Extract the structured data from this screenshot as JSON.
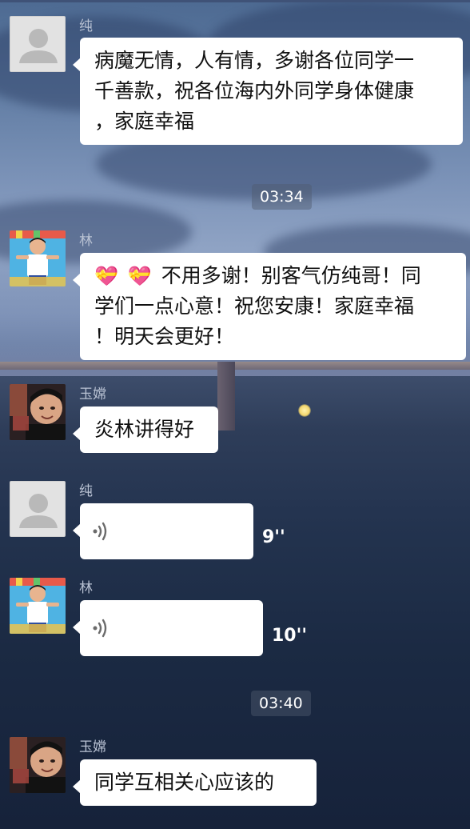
{
  "timestamps": [
    "03:34",
    "03:40"
  ],
  "messages": [
    {
      "sender": "纯",
      "avatar": "default-avatar-icon",
      "type": "text",
      "lines": [
        "病魔无情，人有情，多谢各位同学一",
        "千善款，祝各位海内外同学身体健康",
        "，家庭幸福"
      ]
    },
    {
      "sender": "林",
      "avatar": "child-photo-avatar",
      "type": "text",
      "emoji": [
        "💝",
        "💝"
      ],
      "lines": [
        "不用多谢！别客气仿纯哥！同",
        "学们一点心意！祝您安康！家庭幸福",
        "！明天会更好！"
      ]
    },
    {
      "sender": "玉嫦",
      "avatar": "boy-photo-avatar",
      "type": "text",
      "lines": [
        "炎林讲得好"
      ]
    },
    {
      "sender": "纯",
      "avatar": "default-avatar-icon",
      "type": "voice",
      "duration": "9''"
    },
    {
      "sender": "林",
      "avatar": "child-photo-avatar",
      "type": "voice",
      "duration": "10''"
    },
    {
      "sender": "玉嫦",
      "avatar": "boy-photo-avatar",
      "type": "text",
      "lines": [
        "同学互相关心应该的"
      ]
    }
  ],
  "colors": {
    "bubble": "#ffffff",
    "sender_name": "#b9c2d3",
    "timestamp_bg": "rgba(80,90,110,0.45)"
  }
}
